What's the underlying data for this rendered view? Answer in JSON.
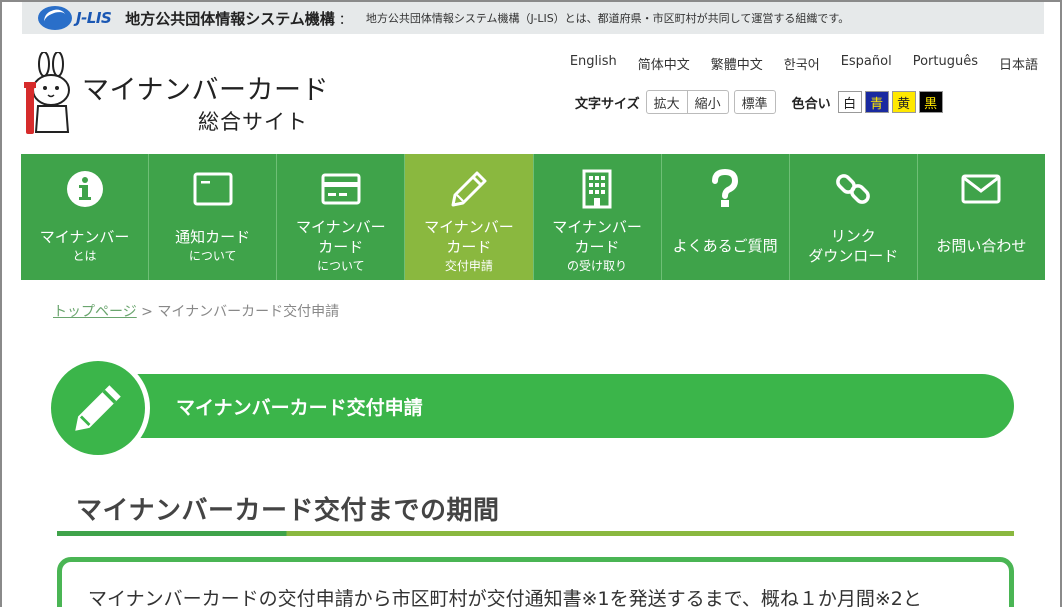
{
  "topbar": {
    "logo_text": "J-LIS",
    "org_name": "地方公共団体情報システム機構",
    "separator": "：",
    "description": "地方公共団体情報システム機構（J-LIS）とは、都道府県・市区町村が共同して運営する組織です。"
  },
  "header": {
    "title_line1": "マイナンバーカード",
    "title_line2": "総合サイト"
  },
  "languages": [
    "English",
    "简体中文",
    "繁體中文",
    "한국어",
    "Español",
    "Português",
    "日本語"
  ],
  "font_size": {
    "label": "文字サイズ",
    "enlarge": "拡大",
    "shrink": "縮小",
    "standard": "標準"
  },
  "color_scheme": {
    "label": "色合い",
    "white": "白",
    "blue": "青",
    "yellow": "黄",
    "black": "黒"
  },
  "nav": [
    {
      "icon": "info-icon",
      "lines": [
        "マイナンバー"
      ],
      "sub": "とは"
    },
    {
      "icon": "card-icon",
      "lines": [
        "通知カード"
      ],
      "sub": "について"
    },
    {
      "icon": "credit-card-icon",
      "lines": [
        "マイナンバー",
        "カード"
      ],
      "sub": "について"
    },
    {
      "icon": "pencil-icon",
      "lines": [
        "マイナンバー",
        "カード"
      ],
      "sub": "交付申請",
      "active": true
    },
    {
      "icon": "building-icon",
      "lines": [
        "マイナンバー",
        "カード"
      ],
      "sub": "の受け取り"
    },
    {
      "icon": "question-icon",
      "lines": [
        "よくあるご質問"
      ],
      "sub": ""
    },
    {
      "icon": "link-icon",
      "lines": [
        "リンク",
        "ダウンロード"
      ],
      "sub": ""
    },
    {
      "icon": "mail-icon",
      "lines": [
        "お問い合わせ"
      ],
      "sub": ""
    }
  ],
  "breadcrumb": {
    "home": "トップページ",
    "separator": " > ",
    "current": "マイナンバーカード交付申請"
  },
  "page_heading": "マイナンバーカード交付申請",
  "section_title": "マイナンバーカード交付までの期間",
  "content_text": "マイナンバーカードの交付申請から市区町村が交付通知書※1を発送するまで、概ね１か月間※2と",
  "colors": {
    "nav_green": "#3fa34a",
    "nav_active": "#8ab83f",
    "heading_green": "#3bb54a"
  }
}
